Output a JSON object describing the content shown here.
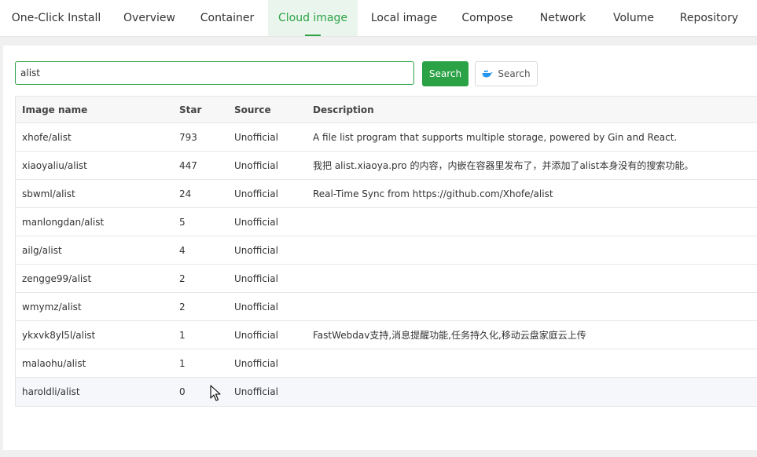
{
  "tabs": [
    {
      "label": "One-Click Install",
      "active": false
    },
    {
      "label": "Overview",
      "active": false
    },
    {
      "label": "Container",
      "active": false
    },
    {
      "label": "Cloud image",
      "active": true
    },
    {
      "label": "Local image",
      "active": false
    },
    {
      "label": "Compose",
      "active": false
    },
    {
      "label": "Network",
      "active": false
    },
    {
      "label": "Volume",
      "active": false
    },
    {
      "label": "Repository",
      "active": false
    }
  ],
  "search": {
    "value": "alist",
    "button_label": "Search",
    "docker_button_label": "Search"
  },
  "table": {
    "columns": [
      "Image name",
      "Star",
      "Source",
      "Description"
    ],
    "rows": [
      {
        "name": "xhofe/alist",
        "star": "793",
        "source": "Unofficial",
        "description": "A file list program that supports multiple storage, powered by Gin and React."
      },
      {
        "name": "xiaoyaliu/alist",
        "star": "447",
        "source": "Unofficial",
        "description": "我把 alist.xiaoya.pro 的内容，内嵌在容器里发布了，并添加了alist本身没有的搜索功能。"
      },
      {
        "name": "sbwml/alist",
        "star": "24",
        "source": "Unofficial",
        "description": "Real-Time Sync from https://github.com/Xhofe/alist"
      },
      {
        "name": "manlongdan/alist",
        "star": "5",
        "source": "Unofficial",
        "description": ""
      },
      {
        "name": "ailg/alist",
        "star": "4",
        "source": "Unofficial",
        "description": ""
      },
      {
        "name": "zengge99/alist",
        "star": "2",
        "source": "Unofficial",
        "description": ""
      },
      {
        "name": "wmymz/alist",
        "star": "2",
        "source": "Unofficial",
        "description": ""
      },
      {
        "name": "ykxvk8yl5l/alist",
        "star": "1",
        "source": "Unofficial",
        "description": "FastWebdav支持,消息提醒功能,任务持久化,移动云盘家庭云上传"
      },
      {
        "name": "malaohu/alist",
        "star": "1",
        "source": "Unofficial",
        "description": ""
      },
      {
        "name": "haroldli/alist",
        "star": "0",
        "source": "Unofficial",
        "description": ""
      }
    ]
  },
  "colors": {
    "accent": "#2ba245",
    "active_tab_bg": "#eaf6ed",
    "docker_blue": "#2496ed"
  },
  "icons": {
    "docker": "docker-whale-icon",
    "cursor": "mouse-pointer-icon"
  }
}
